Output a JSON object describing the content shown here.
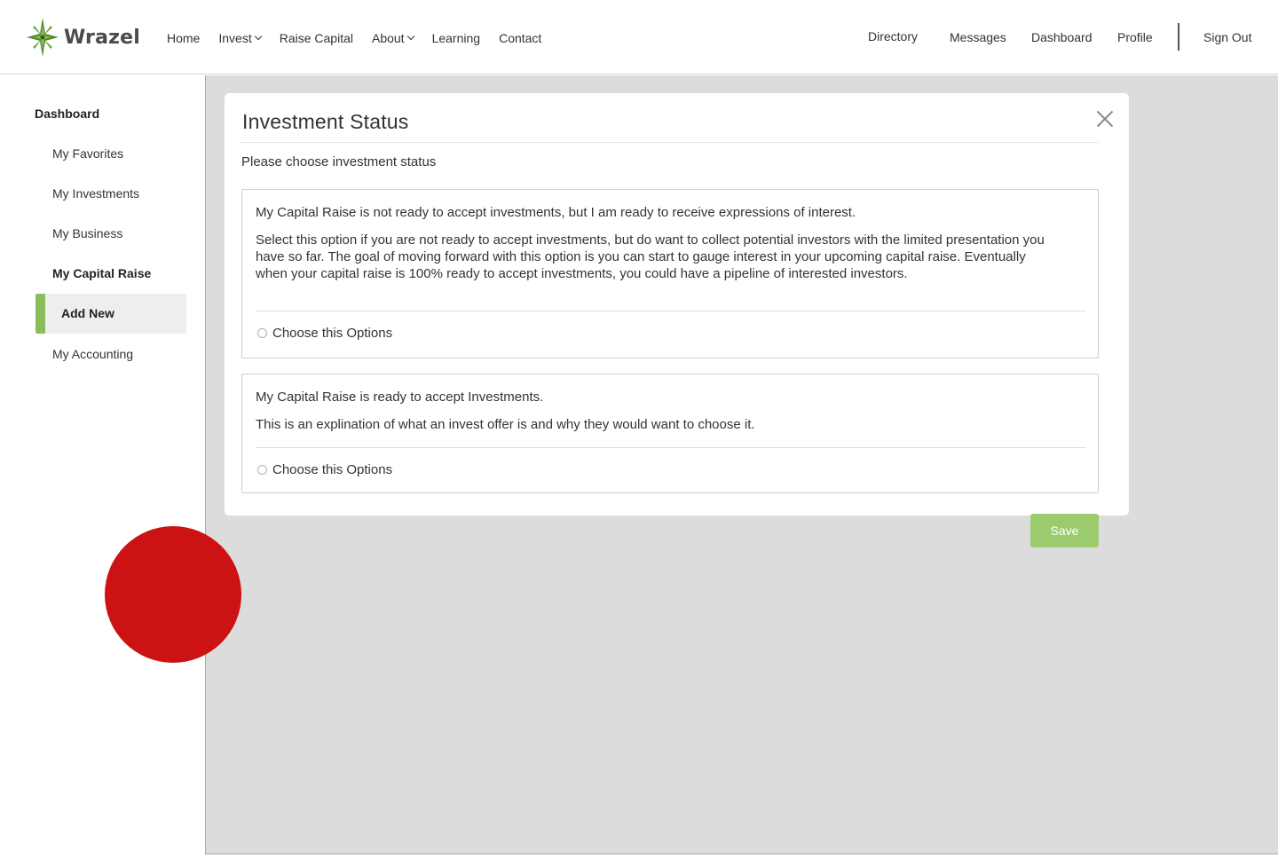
{
  "brand": {
    "name": "Wrazel",
    "accent": "#8bbd5b",
    "logo_color": "#4f8a2c"
  },
  "nav": {
    "left": [
      {
        "label": "Home",
        "has_dropdown": false
      },
      {
        "label": "Invest",
        "has_dropdown": true
      },
      {
        "label": "Raise Capital",
        "has_dropdown": false
      },
      {
        "label": "About",
        "has_dropdown": true
      },
      {
        "label": "Learning",
        "has_dropdown": false
      },
      {
        "label": "Contact",
        "has_dropdown": false
      }
    ],
    "right": {
      "directory": "Directory",
      "messages": "Messages",
      "dashboard": "Dashboard",
      "profile": "Profile",
      "signout": "Sign Out"
    }
  },
  "sidebar": {
    "title": "Dashboard",
    "items": [
      {
        "label": "My Favorites"
      },
      {
        "label": "My Investments"
      },
      {
        "label": "My Business"
      },
      {
        "label": "My Capital Raise"
      },
      {
        "label": "Add New"
      },
      {
        "label": "My Accounting"
      }
    ],
    "active_index": 4
  },
  "modal": {
    "title": "Investment Status",
    "subtitle": "Please choose investment status",
    "options": [
      {
        "heading": "My Capital Raise is not ready to accept investments, but I am ready to receive expressions of interest.",
        "description": "Select this option if you are not ready to accept investments, but do want to collect potential investors with the limited presentation you have so far. The goal of moving forward with this option is you can start to gauge interest in your upcoming capital raise. Eventually when your capital raise is 100% ready to accept investments, you could have a pipeline of interested investors.",
        "choice_label": "Choose this Options",
        "selected": false
      },
      {
        "heading": "My Capital Raise is ready to accept Investments.",
        "description": "This is an explination of what an invest offer is and why they would want to choose it.",
        "choice_label": "Choose this Options",
        "selected": false
      }
    ],
    "save_label": "Save"
  },
  "colors": {
    "save_button": "#9ccb6e",
    "overlay": "#dcdcdc",
    "marker": "#cc1212"
  }
}
